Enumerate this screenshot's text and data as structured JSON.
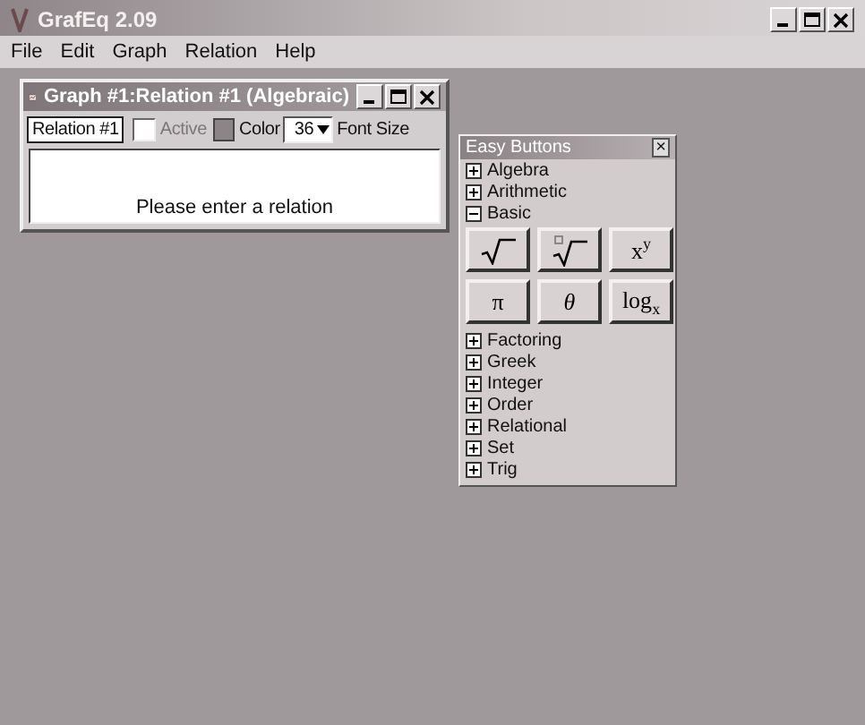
{
  "window": {
    "title": "GrafEq 2.09"
  },
  "menu": [
    "File",
    "Edit",
    "Graph",
    "Relation",
    "Help"
  ],
  "graph_window": {
    "title": "Graph #1:Relation #1 (Algebraic)",
    "relation_name": "Relation #1",
    "active": {
      "label": "Active",
      "checked": false,
      "disabled": true
    },
    "color_label": "Color",
    "font_size": "36",
    "font_size_label": "Font Size",
    "message": "Please enter a relation"
  },
  "easy_buttons": {
    "title": "Easy Buttons",
    "close": "×",
    "categories": [
      {
        "label": "Algebra",
        "expanded": false
      },
      {
        "label": "Arithmetic",
        "expanded": false
      },
      {
        "label": "Basic",
        "expanded": true,
        "buttons": [
          {
            "kind": "sqrt"
          },
          {
            "kind": "root"
          },
          {
            "kind": "text",
            "label": "x$^{y}$"
          },
          {
            "kind": "text",
            "label": "π"
          },
          {
            "kind": "text",
            "label": "θ",
            "italic": true
          },
          {
            "kind": "text",
            "label": "log$_{x}$"
          }
        ]
      },
      {
        "label": "Factoring",
        "expanded": false
      },
      {
        "label": "Greek",
        "expanded": false
      },
      {
        "label": "Integer",
        "expanded": false
      },
      {
        "label": "Order",
        "expanded": false
      },
      {
        "label": "Relational",
        "expanded": false
      },
      {
        "label": "Set",
        "expanded": false
      },
      {
        "label": "Trig",
        "expanded": false
      }
    ]
  }
}
